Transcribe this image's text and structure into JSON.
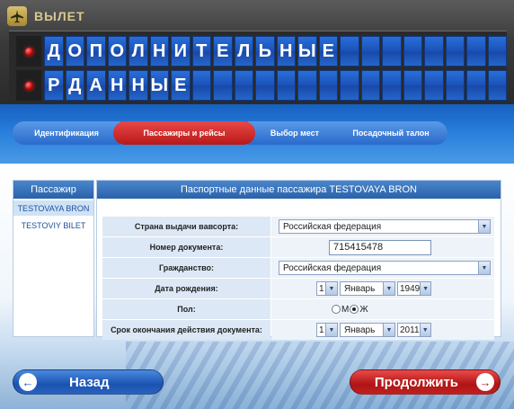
{
  "board": {
    "title": "ВЫЛЕТ",
    "row1": [
      "Д",
      "О",
      "П",
      "О",
      "Л",
      "Н",
      "И",
      "Т",
      "Е",
      "Л",
      "Ь",
      "Н",
      "Ы",
      "Е",
      "",
      "",
      "",
      "",
      "",
      "",
      "",
      ""
    ],
    "row2": [
      "Р",
      "Д",
      "А",
      "Н",
      "Н",
      "Ы",
      "Е",
      "",
      "",
      "",
      "",
      "",
      "",
      "",
      "",
      "",
      "",
      "",
      "",
      "",
      "",
      ""
    ]
  },
  "steps": [
    {
      "label": "Идентификация"
    },
    {
      "label": "Пассажиры и рейсы"
    },
    {
      "label": "Выбор мест"
    },
    {
      "label": "Посадочный талон"
    }
  ],
  "passengers": {
    "header": "Пассажир",
    "items": [
      "TESTOVAYA BRON",
      "TESTOVIY BILET"
    ]
  },
  "passport": {
    "header": "Паспортные данные пассажира TESTOVAYA BRON",
    "country_label": "Страна выдачи вавсорта:",
    "country_value": "Российская федерация",
    "docnum_label": "Номер документа:",
    "docnum_value": "715415478",
    "citizenship_label": "Гражданство:",
    "citizenship_value": "Российская федерация",
    "birth_label": "Дата рождения:",
    "birth_day": "1",
    "birth_month": "Январь",
    "birth_year": "1949",
    "gender_label": "Пол:",
    "gender_m": "М",
    "gender_f": "Ж",
    "expiry_label": "Срок окончания действия документа:",
    "expiry_day": "1",
    "expiry_month": "Январь",
    "expiry_year": "2011"
  },
  "buttons": {
    "back": "Назад",
    "next": "Продолжить"
  },
  "colors": {
    "board_cell": "#1a52b8",
    "active_step": "#c81818",
    "accent_blue": "#2a62aa"
  }
}
